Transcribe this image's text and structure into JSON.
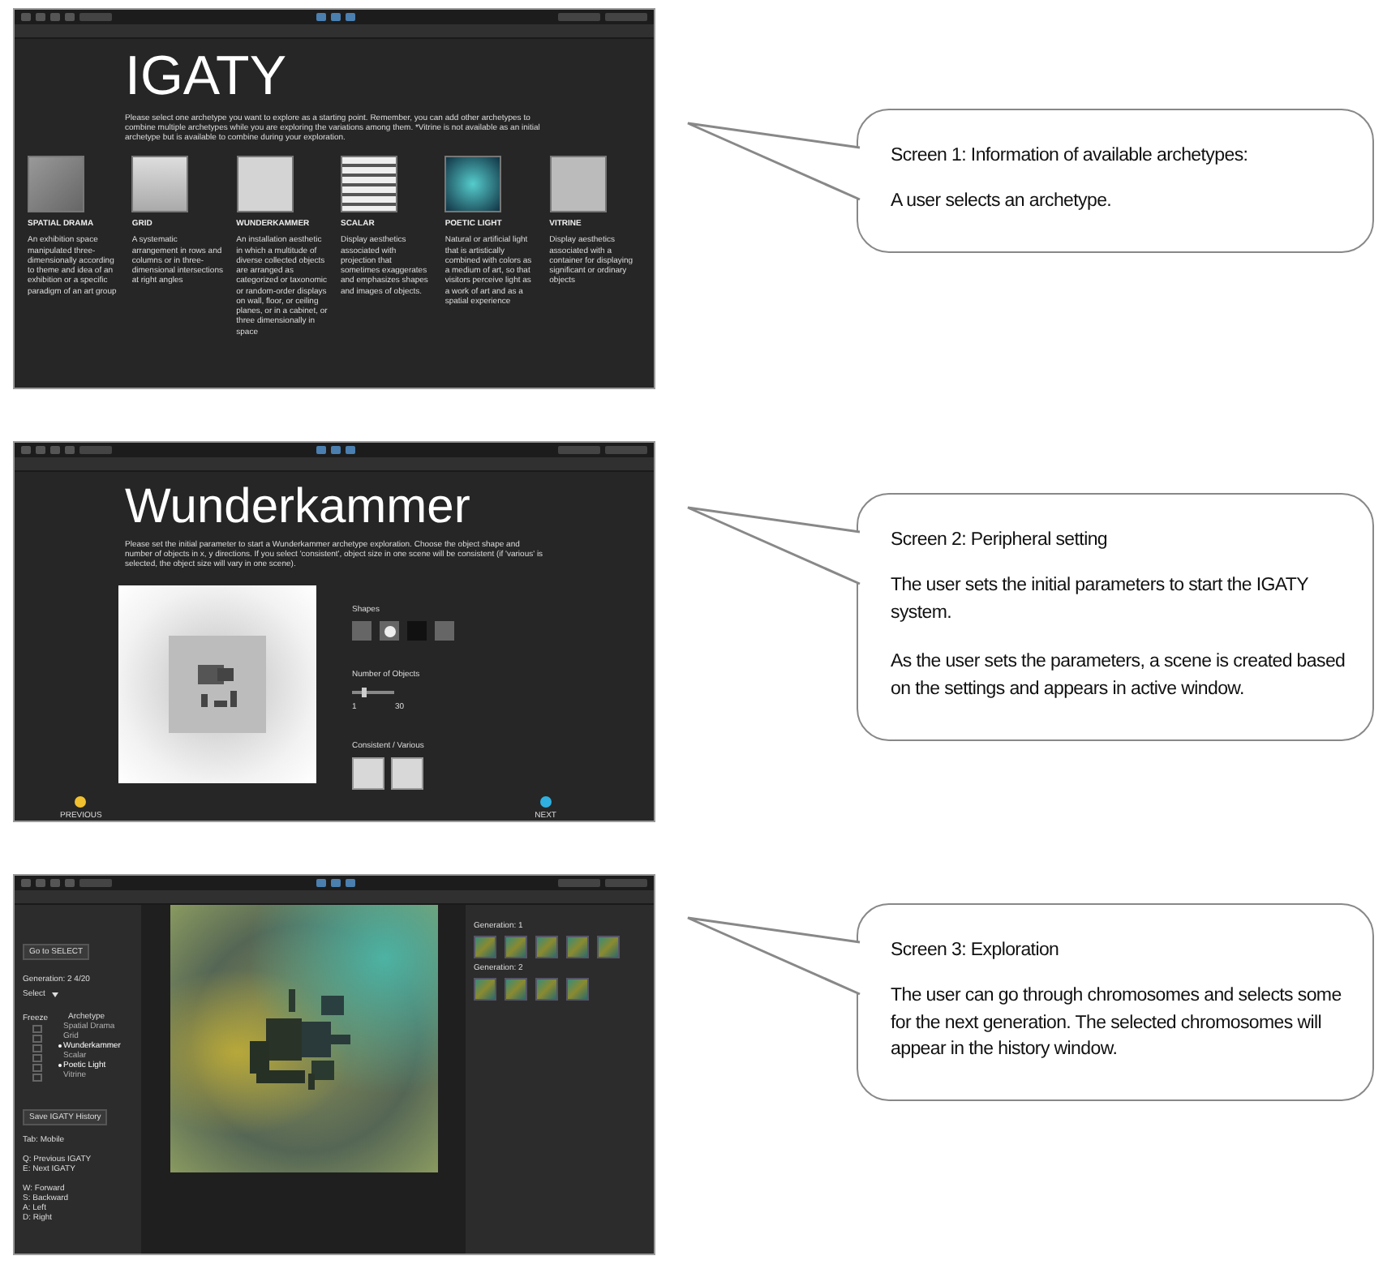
{
  "screens": [
    {
      "kind": "archetypes",
      "title": "IGATY",
      "intro": "Please select one archetype you want to explore as a starting point. Remember, you can add other archetypes to combine multiple archetypes while you are exploring the variations among them. *Vitrine is not available as an initial archetype but is available to combine during your exploration.",
      "archetypes": [
        {
          "name": "SPATIAL DRAMA",
          "description": "An exhibition space manipulated three-dimensionally according to theme and idea of an exhibition or a specific paradigm of an art group"
        },
        {
          "name": "GRID",
          "description": "A systematic arrangement in rows and columns or in three-dimensional intersections at right angles"
        },
        {
          "name": "WUNDERKAMMER",
          "description": "An installation aesthetic in which a multitude of diverse collected objects are arranged as categorized or taxonomic or random-order displays on wall, floor, or ceiling planes, or in a cabinet, or three dimensionally in space"
        },
        {
          "name": "SCALAR",
          "description": "Display aesthetics associated with projection that sometimes exaggerates and emphasizes shapes and images of objects."
        },
        {
          "name": "POETIC LIGHT",
          "description": "Natural or artificial light that is artistically combined with colors as a medium of art, so that visitors perceive light as a work of art and as a spatial experience"
        },
        {
          "name": "VITRINE",
          "description": "Display aesthetics associated with a container for displaying significant or ordinary objects"
        }
      ]
    },
    {
      "kind": "setting",
      "title": "Wunderkammer",
      "intro": "Please set the initial parameter to start a Wunderkammer archetype exploration. Choose the object shape and number of objects in x, y directions. If you select 'consistent', object size in one scene will be consistent (if 'various' is selected, the object size will vary in one scene).",
      "shapes_label": "Shapes",
      "count_label": "Number of Objects",
      "count": {
        "level": 0.3,
        "min": "1",
        "max": "30"
      },
      "size_label": "Consistent / Various",
      "previous": "PREVIOUS",
      "next": "NEXT"
    },
    {
      "kind": "exploration",
      "go_button": "Go to SELECT",
      "generation": "Generation: 2  4/20",
      "select_label": "Select",
      "freeze_label": "Freeze",
      "archetype_label": "Archetype",
      "archetypes": [
        {
          "label": "Spatial Drama",
          "selected": false,
          "checked": false
        },
        {
          "label": "Grid",
          "selected": false,
          "checked": false
        },
        {
          "label": "Wunderkammer",
          "selected": true,
          "checked": false
        },
        {
          "label": "Scalar",
          "selected": false,
          "checked": false
        },
        {
          "label": "Poetic Light",
          "selected": true,
          "checked": false
        },
        {
          "label": "Vitrine",
          "selected": false,
          "checked": false
        }
      ],
      "save_button": "Save IGATY History",
      "keys": [
        [
          "Tab: Mobile"
        ],
        [
          "Q: Previous IGATY",
          "E: Next IGATY"
        ],
        [
          "W: Forward",
          "S: Backward",
          "A: Left",
          "D: Right"
        ]
      ],
      "history": [
        {
          "label": "Generation: 1"
        },
        {
          "label": "Generation: 2"
        }
      ]
    }
  ],
  "callouts": [
    {
      "title": "Screen 1: Information of available archetypes:",
      "paragraphs": [
        "A user selects an archetype."
      ]
    },
    {
      "title": "Screen 2: Peripheral setting",
      "paragraphs": [
        "The user sets the initial parameters to start the IGATY system.",
        "As the user sets the parameters, a scene is created based on the settings and appears in active window."
      ]
    },
    {
      "title": "Screen 3: Exploration",
      "paragraphs": [
        "The user can go through chromosomes and selects some for the next generation. The selected chromosomes will appear in the history window."
      ]
    }
  ]
}
